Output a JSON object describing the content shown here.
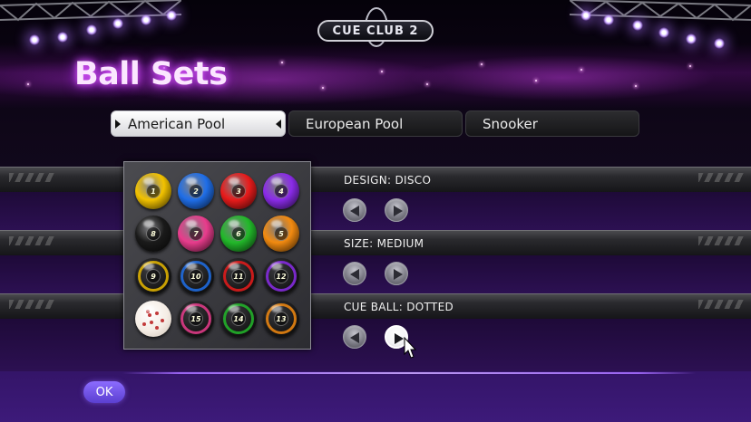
{
  "logo": {
    "text": "CUE CLUB 2"
  },
  "page": {
    "title": "Ball Sets"
  },
  "tabs": [
    {
      "label": "American Pool",
      "active": true
    },
    {
      "label": "European Pool",
      "active": false
    },
    {
      "label": "Snooker",
      "active": false
    }
  ],
  "options": {
    "design": {
      "label": "DESIGN: DISCO"
    },
    "size": {
      "label": "SIZE: MEDIUM"
    },
    "cue_ball": {
      "label": "CUE BALL: DOTTED"
    }
  },
  "balls": [
    {
      "number": "1",
      "color": "#f2c200",
      "striped": false
    },
    {
      "number": "2",
      "color": "#1f6ee8",
      "striped": false
    },
    {
      "number": "3",
      "color": "#e81b1b",
      "striped": false
    },
    {
      "number": "4",
      "color": "#8a2be8",
      "striped": false
    },
    {
      "number": "8",
      "color": "#1a1a1a",
      "striped": false
    },
    {
      "number": "7",
      "color": "#e83c8c",
      "striped": false
    },
    {
      "number": "6",
      "color": "#22b82a",
      "striped": false
    },
    {
      "number": "5",
      "color": "#f28a10",
      "striped": false
    },
    {
      "number": "9",
      "color": "#e8b800",
      "striped": true
    },
    {
      "number": "10",
      "color": "#1f6ee8",
      "striped": true
    },
    {
      "number": "11",
      "color": "#e81b1b",
      "striped": true
    },
    {
      "number": "12",
      "color": "#8a2be8",
      "striped": true
    },
    {
      "number": "",
      "color": "#f4ece4",
      "striped": false,
      "cue": true
    },
    {
      "number": "15",
      "color": "#e83c8c",
      "striped": true
    },
    {
      "number": "14",
      "color": "#22b82a",
      "striped": true
    },
    {
      "number": "13",
      "color": "#f28a10",
      "striped": true
    }
  ],
  "ok_button": {
    "label": "OK"
  },
  "colors": {
    "accent": "#a46cff",
    "title_glow": "#e05cff"
  }
}
